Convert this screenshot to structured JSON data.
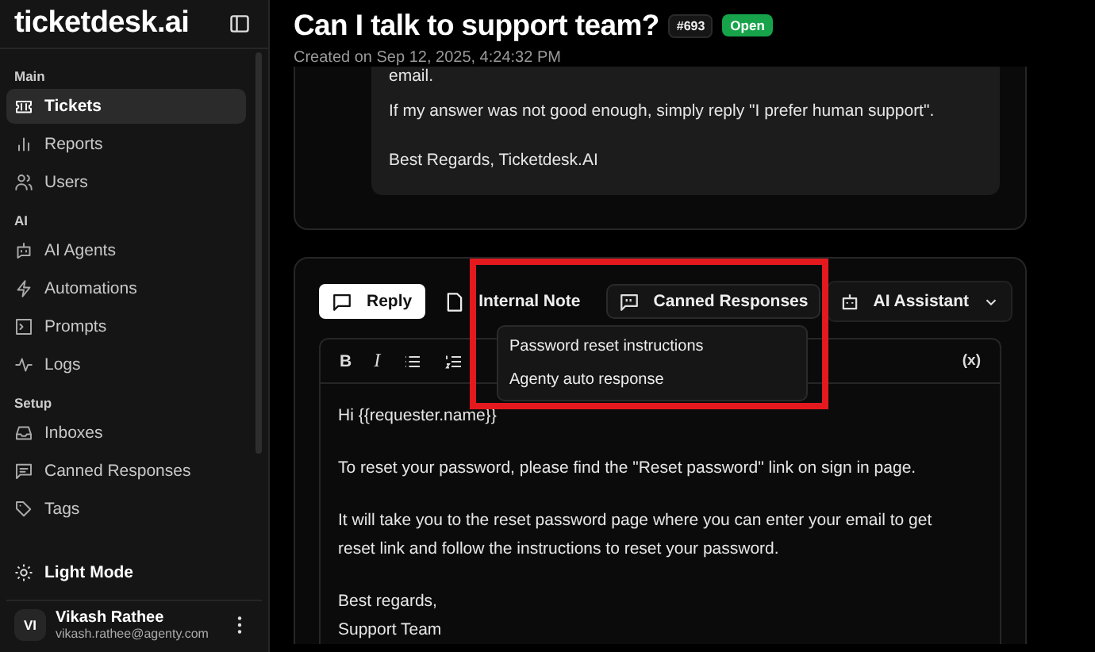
{
  "sidebar": {
    "logo": "ticketdesk.ai",
    "sections": [
      {
        "label": "Main",
        "items": [
          {
            "label": "Tickets",
            "selected": true
          },
          {
            "label": "Reports",
            "selected": false
          },
          {
            "label": "Users",
            "selected": false
          }
        ]
      },
      {
        "label": "AI",
        "items": [
          {
            "label": "AI Agents",
            "selected": false
          },
          {
            "label": "Automations",
            "selected": false
          },
          {
            "label": "Prompts",
            "selected": false
          },
          {
            "label": "Logs",
            "selected": false
          }
        ]
      },
      {
        "label": "Setup",
        "items": [
          {
            "label": "Inboxes",
            "selected": false
          },
          {
            "label": "Canned Responses",
            "selected": false
          },
          {
            "label": "Tags",
            "selected": false
          }
        ]
      }
    ],
    "theme_toggle": "Light Mode",
    "user": {
      "initials": "VI",
      "name": "Vikash Rathee",
      "email": "vikash.rathee@agenty.com"
    }
  },
  "ticket": {
    "title": "Can I talk to support team?",
    "number": "#693",
    "status": "Open",
    "created": "Created on Sep 12, 2025, 4:24:32 PM"
  },
  "message": {
    "lines": [
      "email.",
      "If my answer was not good enough, simply reply \"I prefer human support\".",
      "Best Regards, Ticketdesk.AI"
    ]
  },
  "composer": {
    "tabs": [
      {
        "label": "Reply",
        "selected": true
      },
      {
        "label": "Internal Note",
        "selected": false
      }
    ],
    "canned_button": "Canned Responses",
    "ai_button": "AI Assistant",
    "format_buttons": [
      "B",
      "I"
    ],
    "variable_button": "(x)",
    "paragraphs": [
      [
        "Hi {{requester.name}}"
      ],
      [
        "To reset your password, please find the \"Reset password\" link on sign in page."
      ],
      [
        "It will take you to the reset password page where you can enter your email to get",
        "reset link and follow the instructions to reset your password."
      ],
      [
        "Best regards,",
        "Support Team"
      ]
    ],
    "dropdown": [
      "Password reset instructions",
      "Agenty auto response"
    ]
  }
}
